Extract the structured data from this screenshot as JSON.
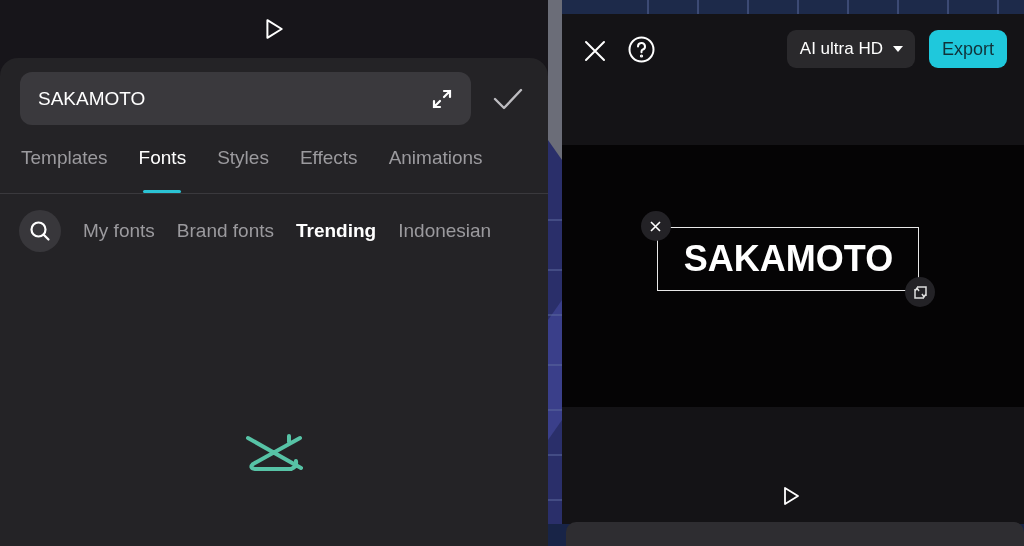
{
  "editor": {
    "text_value": "SAKAMOTO",
    "tabs": [
      {
        "label": "Templates",
        "selected": false
      },
      {
        "label": "Fonts",
        "selected": true
      },
      {
        "label": "Styles",
        "selected": false
      },
      {
        "label": "Effects",
        "selected": false
      },
      {
        "label": "Animations",
        "selected": false
      }
    ],
    "font_categories": [
      {
        "label": "My fonts",
        "selected": false
      },
      {
        "label": "Brand fonts",
        "selected": false
      },
      {
        "label": "Trending",
        "selected": true
      },
      {
        "label": "Indonesian",
        "selected": false
      }
    ]
  },
  "preview": {
    "quality": "AI ultra HD",
    "export": "Export",
    "overlay_text": "SAKAMOTO"
  }
}
